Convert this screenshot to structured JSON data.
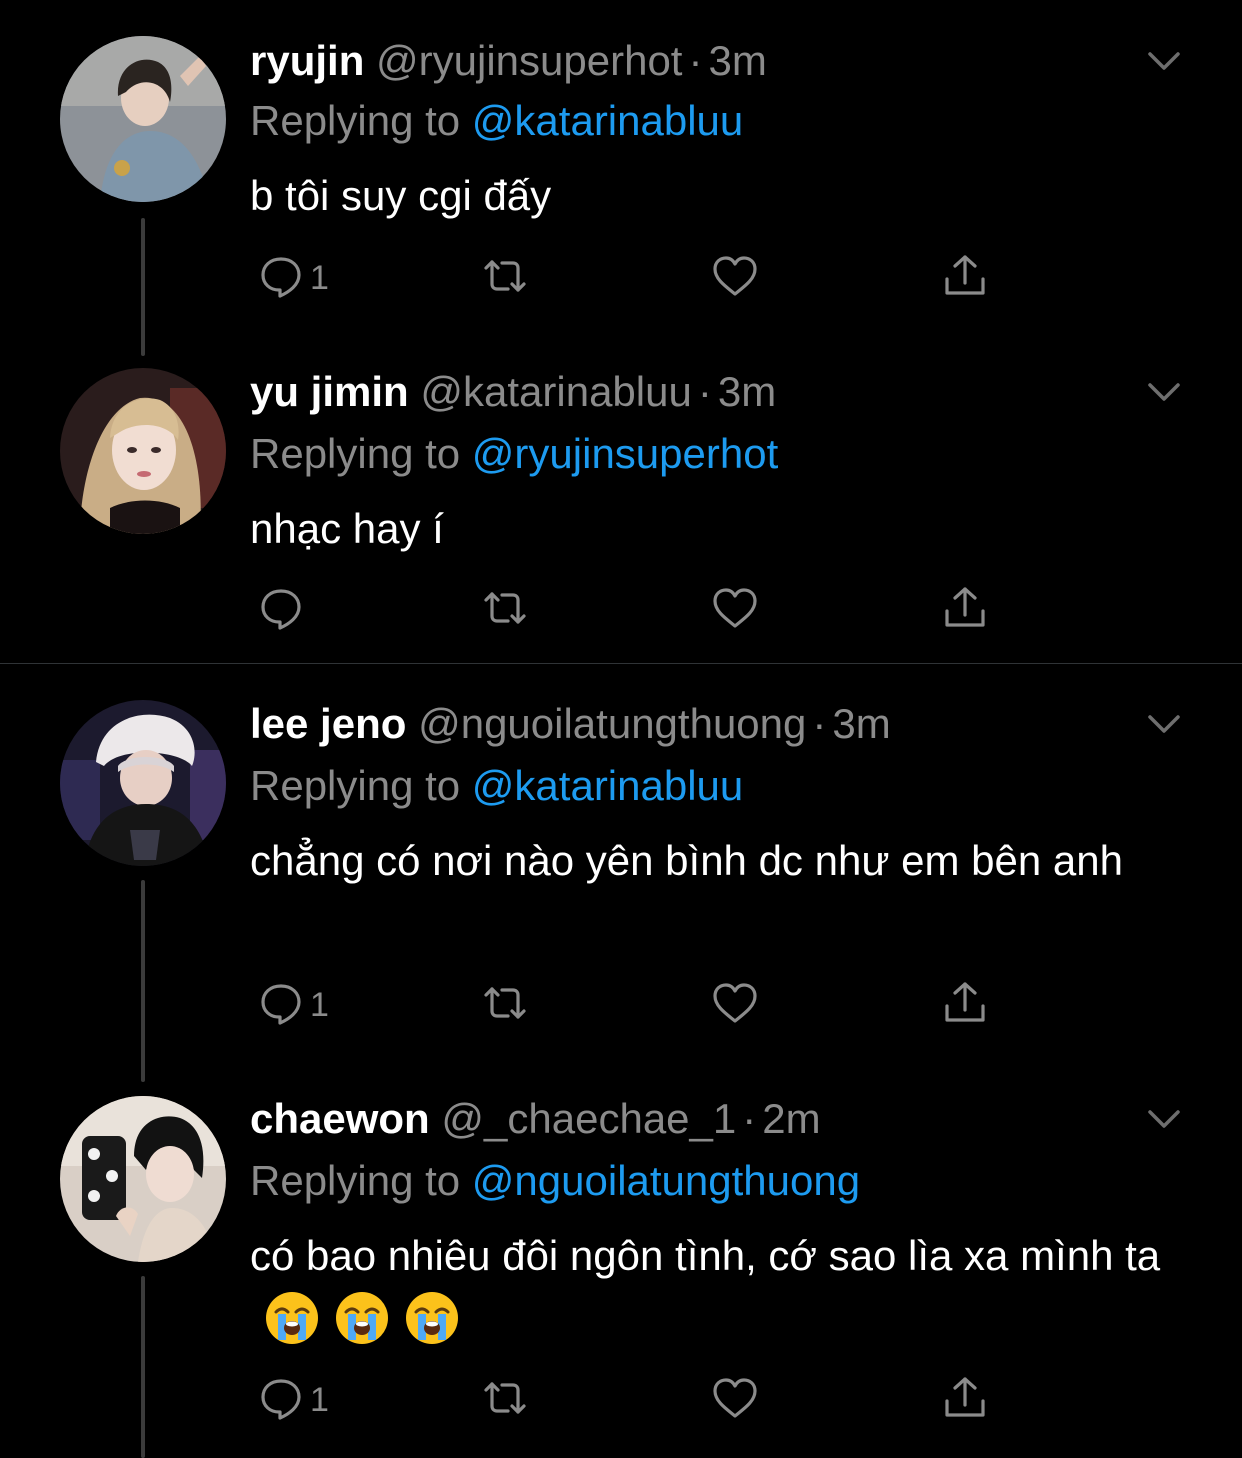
{
  "tweets": [
    {
      "name": "ryujin",
      "handle": "@ryujinsuperhot",
      "separator": "·",
      "time": "3m",
      "replying_label": "Replying to",
      "replying_to": "@katarinabluu",
      "text": "b tôi suy cgi đấy",
      "reply_count": "1",
      "emojis": []
    },
    {
      "name": "yu jimin",
      "handle": "@katarinabluu",
      "separator": "·",
      "time": "3m",
      "replying_label": "Replying to",
      "replying_to": "@ryujinsuperhot",
      "text": "nhạc hay í",
      "reply_count": "",
      "emojis": []
    },
    {
      "name": "lee jeno",
      "handle": "@nguoilatungthuong",
      "separator": "·",
      "time": "3m",
      "replying_label": "Replying to",
      "replying_to": "@katarinabluu",
      "text": "chẳng có nơi nào yên bình dc như em bên anh",
      "reply_count": "1",
      "emojis": []
    },
    {
      "name": "chaewon",
      "handle": "@_chaechae_1",
      "separator": "·",
      "time": "2m",
      "replying_label": "Replying to",
      "replying_to": "@nguoilatungthuong",
      "text": "có bao nhiêu đôi ngôn tình, cớ sao lìa xa mình ta",
      "reply_count": "1",
      "emojis": [
        "loudly-crying-face",
        "loudly-crying-face",
        "loudly-crying-face"
      ]
    }
  ],
  "colors": {
    "background": "#000000",
    "text": "#ffffff",
    "secondary": "#8b8b8b",
    "link": "#1d9bf0",
    "thread_line": "#3b3b3b"
  },
  "icons": {
    "reply": "comment-icon",
    "retweet": "retweet-icon",
    "like": "heart-icon",
    "share": "share-icon",
    "menu": "chevron-down-icon"
  }
}
